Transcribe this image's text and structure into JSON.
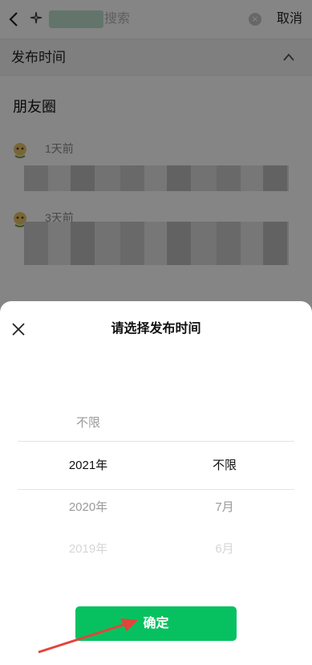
{
  "header": {
    "search_placeholder": "搜索",
    "cancel_label": "取消",
    "clear_glyph": "×"
  },
  "filter": {
    "label": "发布时间"
  },
  "feed": {
    "section_title": "朋友圈",
    "posts": [
      {
        "time": "1天前"
      },
      {
        "time": "3天前"
      }
    ]
  },
  "sheet": {
    "title": "请选择发布时间",
    "year_options": [
      "不限",
      "2021年",
      "2020年",
      "2019年"
    ],
    "month_options": [
      "不限",
      "7月",
      "6月"
    ],
    "selected_year": "2021年",
    "selected_month": "不限",
    "confirm_label": "确定"
  },
  "colors": {
    "accent": "#07c160",
    "annotation_arrow": "#e2453a"
  },
  "icons": [
    "back-icon",
    "sparkle-icon",
    "clear-icon",
    "chevron-up-icon",
    "avatar-icon",
    "close-icon"
  ]
}
